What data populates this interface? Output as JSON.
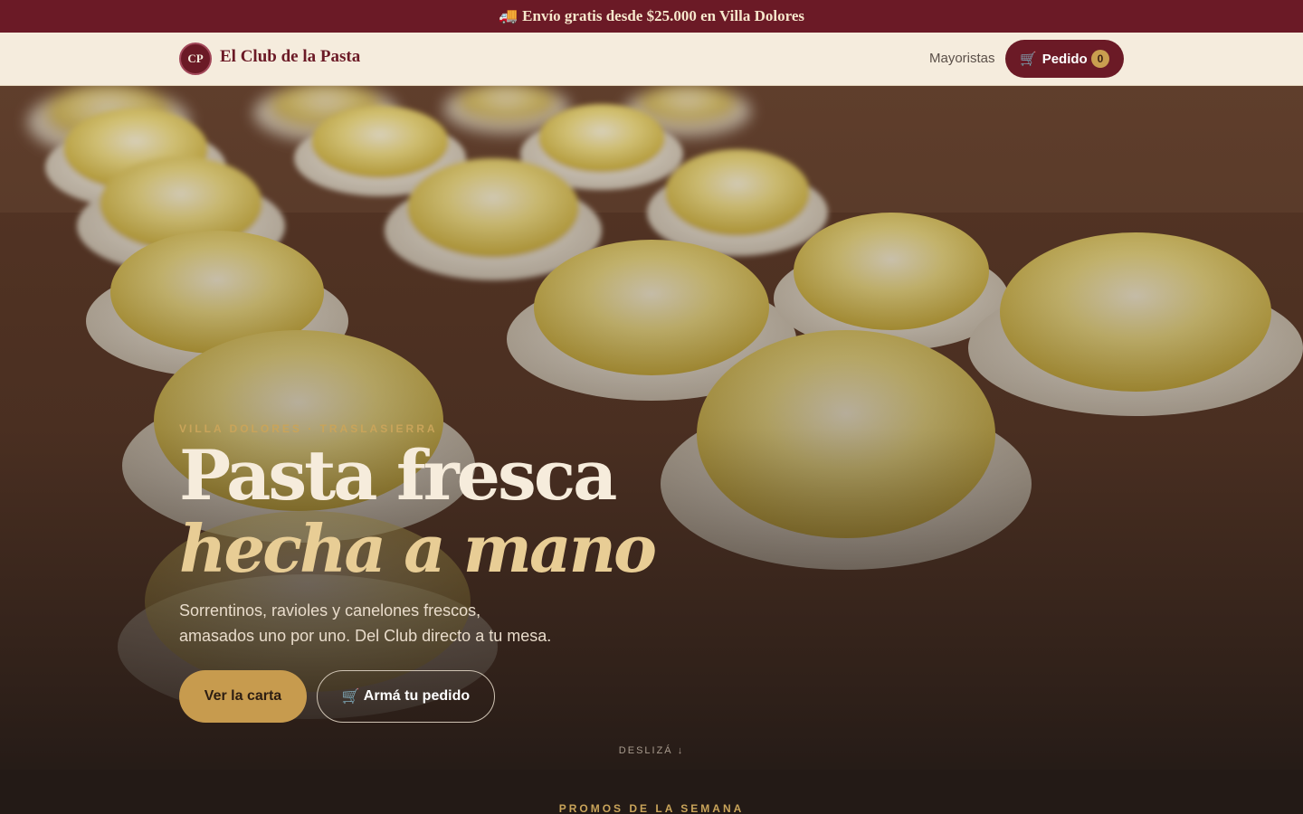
{
  "announcement": {
    "icon": "truck-icon",
    "glyph": "🚚",
    "text": "Envío gratis desde $25.000 en Villa Dolores"
  },
  "header": {
    "logo_initials": "CP",
    "brand_name": "El Club de la Pasta",
    "nav_link": "Mayoristas",
    "order_button": {
      "icon": "cart-icon",
      "glyph": "🛒",
      "label": "Pedido",
      "count": "0"
    }
  },
  "hero": {
    "eyebrow": "VILLA DOLORES · TRASLASIERRA",
    "title_line1": "Pasta fresca",
    "title_line2": "hecha a mano",
    "subtitle_line1": "Sorrentinos, ravioles y canelones frescos,",
    "subtitle_line2": "amasados uno por uno. Del Club directo a tu mesa.",
    "primary_cta": "Ver la carta",
    "secondary_cta": {
      "glyph": "🛒",
      "label": "Armá tu pedido"
    },
    "scroll_hint": "DESLIZÁ ↓",
    "background_image": "pasta-ravioli-photo"
  },
  "promos": {
    "eyebrow": "PROMOS DE LA SEMANA"
  },
  "colors": {
    "brand_burgundy": "#6b1a26",
    "header_cream": "#f5ecdd",
    "accent_gold": "#c79b4e",
    "title_cream": "#f6ecdc",
    "title_italic_gold": "#e8cd95",
    "dark_bg": "#231a16"
  }
}
